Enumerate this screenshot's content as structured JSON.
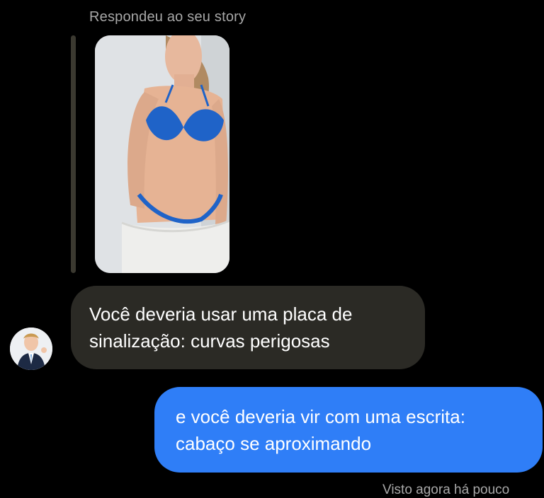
{
  "story_reply": {
    "label": "Respondeu ao seu story",
    "thumbnail_desc": "story-photo"
  },
  "messages": [
    {
      "direction": "received",
      "lines": [
        "Você deveria usar uma placa de",
        "sinalização: curvas perigosas"
      ]
    },
    {
      "direction": "sent",
      "lines": [
        "e você deveria vir com uma escrita:",
        "cabaço se aproximando"
      ]
    }
  ],
  "seen_status": "Visto agora há pouco",
  "colors": {
    "background": "#000000",
    "received_bubble": "#2b2a25",
    "sent_bubble": "#2f7ef7",
    "meta_text": "#a8a8a8"
  }
}
